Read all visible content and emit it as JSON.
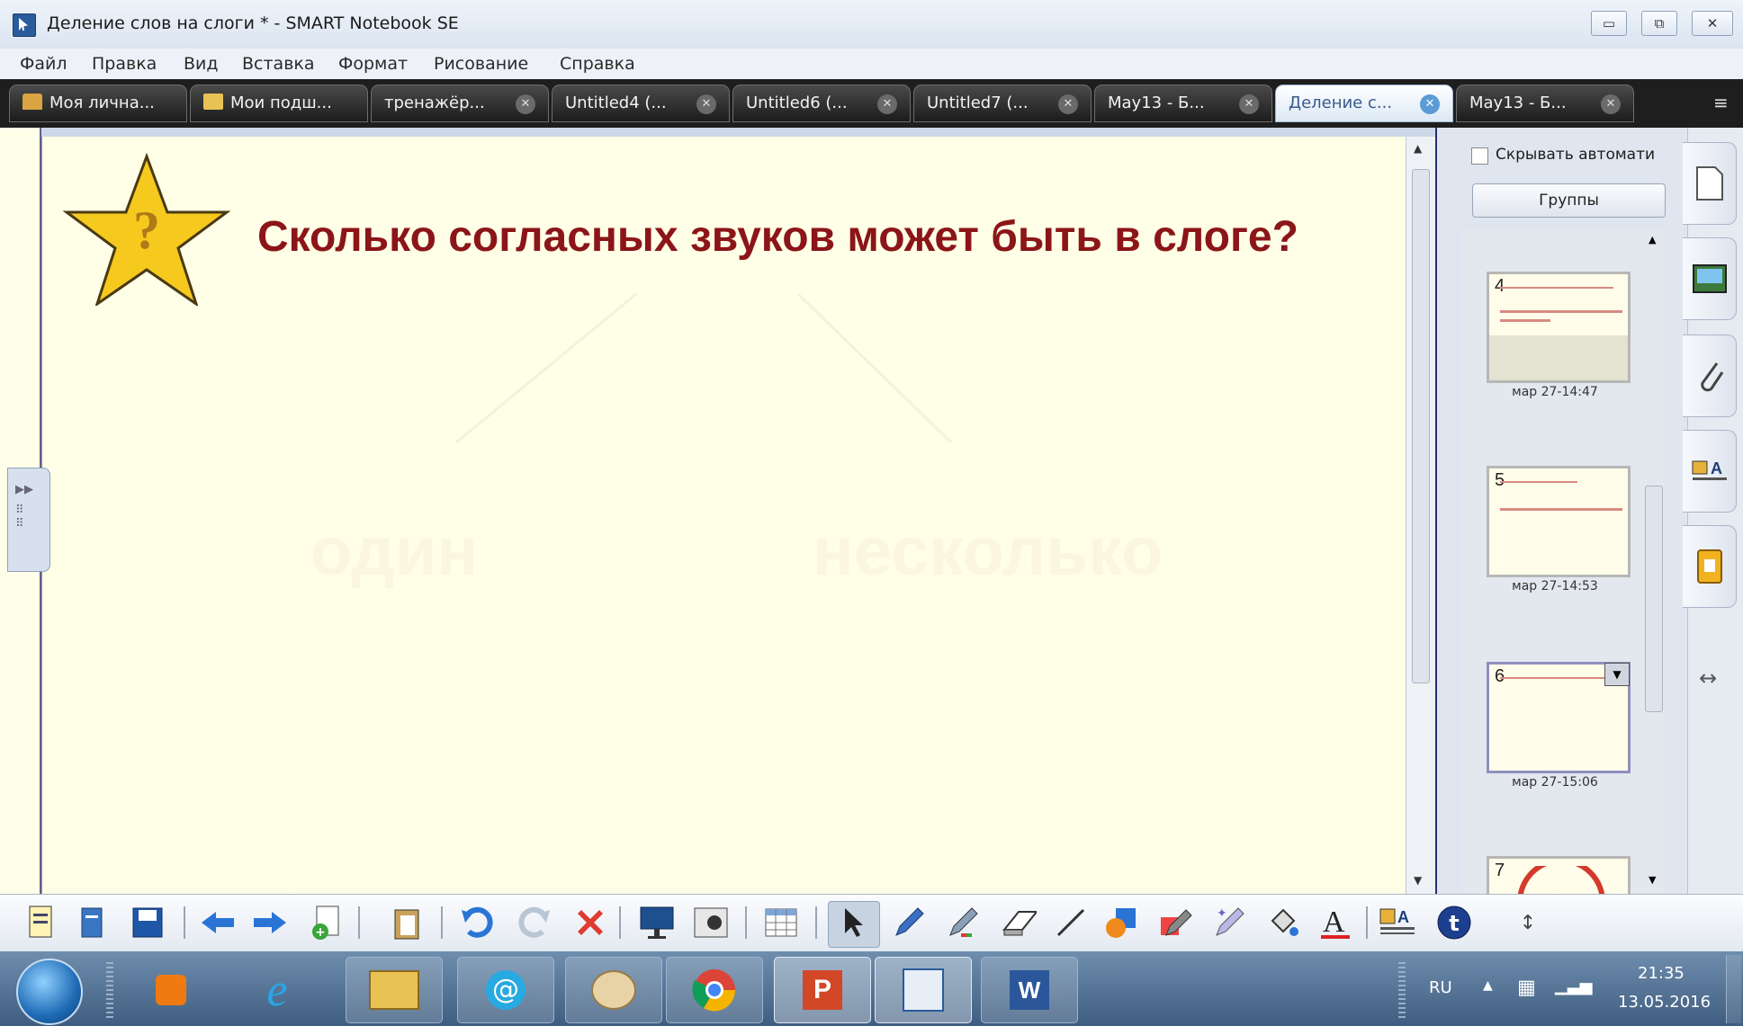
{
  "window": {
    "title": "Деление слов на слоги * - SMART Notebook SE",
    "buttons": {
      "minimize": "▭",
      "restore": "⧉",
      "close": "✕"
    }
  },
  "menu": [
    "Файл",
    "Правка",
    "Вид",
    "Вставка",
    "Формат",
    "Рисование",
    "Справка"
  ],
  "tabs": [
    {
      "label": "Моя лична...",
      "icon": "home-folder-icon",
      "closable": false
    },
    {
      "label": "Мои подш...",
      "icon": "folder-icon",
      "closable": false
    },
    {
      "label": "тренажёр...",
      "closable": true
    },
    {
      "label": "Untitled4 (...",
      "closable": true
    },
    {
      "label": "Untitled6 (...",
      "closable": true
    },
    {
      "label": "Untitled7 (...",
      "closable": true
    },
    {
      "label": "May13 - Б...",
      "closable": true
    },
    {
      "label": "Деление с...",
      "closable": true,
      "active": true
    },
    {
      "label": "May13 - Б...",
      "closable": true
    }
  ],
  "page": {
    "question": "Сколько согласных звуков может быть в слоге?",
    "faded_words": [
      "один",
      "несколько"
    ],
    "star_symbol": "?"
  },
  "side_panel": {
    "auto_hide_label": "Скрывать автомати",
    "groups_button": "Группы",
    "pages": [
      {
        "number": "4",
        "date": "мар 27-14:47"
      },
      {
        "number": "5",
        "date": "мар 27-14:53"
      },
      {
        "number": "6",
        "date": "мар 27-15:06",
        "selected": true
      },
      {
        "number": "7",
        "date": ""
      }
    ],
    "tabs": [
      "page-sorter-icon",
      "gallery-icon",
      "attachments-icon",
      "properties-icon",
      "addons-icon"
    ],
    "resize_symbol": "↔"
  },
  "taskbar": {
    "language": "RU",
    "time": "21:35",
    "date": "13.05.2016"
  },
  "colors": {
    "page_bg": "#fffee6",
    "question_text": "#8b1518",
    "tab_active": "#dce8f6"
  }
}
